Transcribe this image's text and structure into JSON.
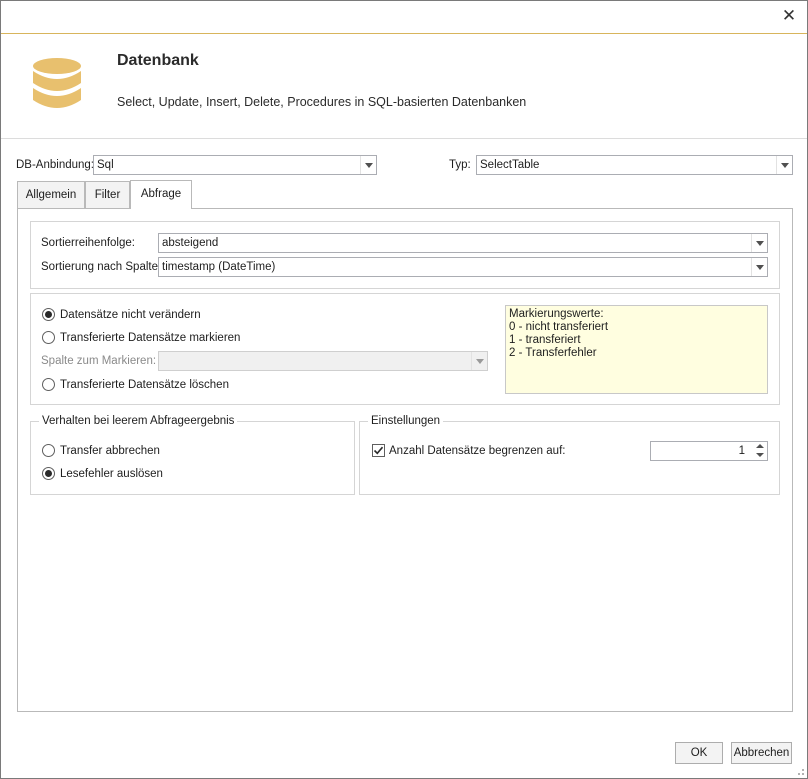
{
  "window": {
    "close_glyph": "✕"
  },
  "header": {
    "title": "Datenbank",
    "subtitle": "Select, Update, Insert, Delete, Procedures in SQL-basierten Datenbanken",
    "icon": "database-icon",
    "icon_color": "#e8c06e"
  },
  "top": {
    "db_connection_label": "DB-Anbindung:",
    "db_connection_value": "Sql",
    "type_label": "Typ:",
    "type_value": "SelectTable"
  },
  "tabs": [
    {
      "label": "Allgemein",
      "active": false
    },
    {
      "label": "Filter",
      "active": false
    },
    {
      "label": "Abfrage",
      "active": true
    }
  ],
  "sort": {
    "order_label": "Sortierreihenfolge:",
    "order_value": "absteigend",
    "column_label": "Sortierung nach Spalte:",
    "column_value": "timestamp (DateTime)"
  },
  "records": {
    "option_no_change": "Datensätze nicht verändern",
    "option_mark": "Transferierte Datensätze markieren",
    "mark_column_label": "Spalte zum Markieren:",
    "mark_column_value": "",
    "option_delete": "Transferierte Datensätze löschen",
    "selected": "no_change",
    "marker_values": "Markierungswerte:\n0 - nicht transferiert\n1 - transferiert\n2 - Transferfehler"
  },
  "empty_result": {
    "title": "Verhalten bei leerem Abfrageergebnis",
    "option_abort": "Transfer abbrechen",
    "option_read_error": "Lesefehler auslösen",
    "selected": "read_error"
  },
  "settings": {
    "title": "Einstellungen",
    "limit_label": "Anzahl Datensätze begrenzen auf:",
    "limit_checked": true,
    "limit_value": "1"
  },
  "footer": {
    "ok_label": "OK",
    "cancel_label": "Abbrechen"
  },
  "colors": {
    "accent_line": "#d8b55c",
    "memo_background": "#fffee0"
  }
}
